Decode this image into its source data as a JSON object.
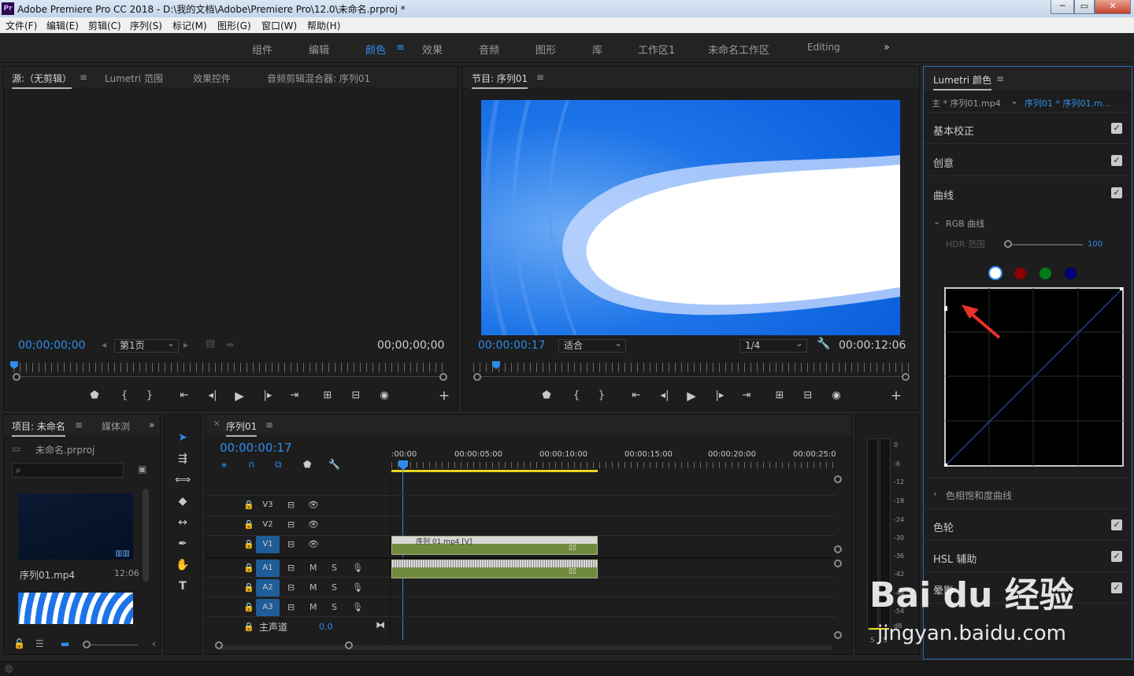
{
  "window": {
    "title": "Adobe Premiere Pro CC 2018 - D:\\我的文档\\Adobe\\Premiere Pro\\12.0\\未命名.prproj *",
    "logo": "Pr"
  },
  "menu": [
    "文件(F)",
    "编辑(E)",
    "剪辑(C)",
    "序列(S)",
    "标记(M)",
    "图形(G)",
    "窗口(W)",
    "帮助(H)"
  ],
  "workspaces": [
    "组件",
    "编辑",
    "颜色",
    "效果",
    "音频",
    "图形",
    "库",
    "工作区1",
    "未命名工作区",
    "Editing"
  ],
  "workspace_active": "颜色",
  "source": {
    "tabs": [
      "源:（无剪辑）",
      "Lumetri 范围",
      "效果控件",
      "音频剪辑混合器: 序列01"
    ],
    "timecode_left": "00;00;00;00",
    "timecode_right": "00;00;00;00",
    "page_select": "第1页"
  },
  "program": {
    "tab": "节目: 序列01",
    "timecode_left": "00:00:00:17",
    "timecode_right": "00:00:12:06",
    "fit": "适合",
    "resolution": "1/4"
  },
  "project": {
    "tabs": [
      "项目: 未命名",
      "媒体浏"
    ],
    "file": "未命名.prproj",
    "search_placeholder": "",
    "clip_name": "序列01.mp4",
    "clip_duration": "12:06"
  },
  "timeline": {
    "tab": "序列01",
    "timecode": "00:00:00:17",
    "ruler": [
      ":00:00",
      "00:00:05:00",
      "00:00:10:00",
      "00:00:15:00",
      "00:00:20:00",
      "00:00:25:0"
    ],
    "video_tracks": [
      "V3",
      "V2",
      "V1"
    ],
    "audio_tracks": [
      "A1",
      "A2",
      "A3"
    ],
    "master": "主声道",
    "master_value": "0.0",
    "video_clip_label": "序列 01.mp4 [V]",
    "mute": "M",
    "solo": "S"
  },
  "meter": {
    "ticks": [
      "0",
      "-6",
      "-12",
      "-18",
      "-24",
      "-30",
      "-36",
      "-42",
      "-48",
      "-54"
    ],
    "unit": "dB",
    "solo_labels": [
      "S",
      "S"
    ]
  },
  "lumetri": {
    "title": "Lumetri 颜色",
    "source_label": "主 * 序列01.mp4",
    "seq_label": "序列01 * 序列01.m...",
    "sections": [
      "基本校正",
      "创意",
      "曲线"
    ],
    "rgb_curves": "RGB 曲线",
    "hdr_label": "HDR 范围",
    "hdr_value": "100",
    "hue_sat": "色相饱和度曲线",
    "more_sections": [
      "色轮",
      "HSL 辅助",
      "晕影"
    ]
  },
  "watermark": {
    "text": "Bai du 经验",
    "url": "jingyan.baidu.com"
  },
  "colors": {
    "accent": "#2d8ceb",
    "clip_green": "#6f8a3c",
    "panel": "#1d1d1d",
    "arrow": "#e8312a"
  }
}
